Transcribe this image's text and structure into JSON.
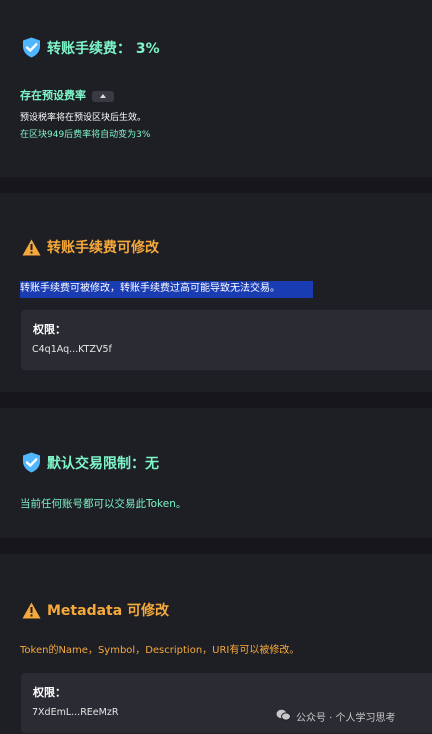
{
  "sections": {
    "fee": {
      "title": "转账手续费： 3%",
      "preset_label": "存在预设费率",
      "desc": "预设税率将在预设区块后生效。",
      "note": "在区块949后费率将自动变为3%"
    },
    "fee_mod": {
      "title": "转账手续费可修改",
      "desc": "转账手续费可被修改，转账手续费过高可能导致无法交易。",
      "perm_label": "权限：",
      "perm_value": "C4q1Aq...KTZV5f"
    },
    "trade_limit": {
      "title": "默认交易限制：无",
      "desc": "当前任何账号都可以交易此Token。"
    },
    "metadata": {
      "title": "Metadata 可修改",
      "desc": "Token的Name，Symbol，Description，URI有可以被修改。",
      "perm_label": "权限：",
      "perm_value": "7XdEmL...REeMzR"
    }
  },
  "watermark": "公众号 · 个人学习思考",
  "colors": {
    "green": "#7ef5c8",
    "orange": "#f6a93b",
    "card": "#1e1f25",
    "background": "#16161b",
    "highlight": "#1a3cb3"
  },
  "icons": {
    "safe": "shield-check-icon",
    "warning": "warning-icon",
    "watermark": "wechat-icon"
  }
}
